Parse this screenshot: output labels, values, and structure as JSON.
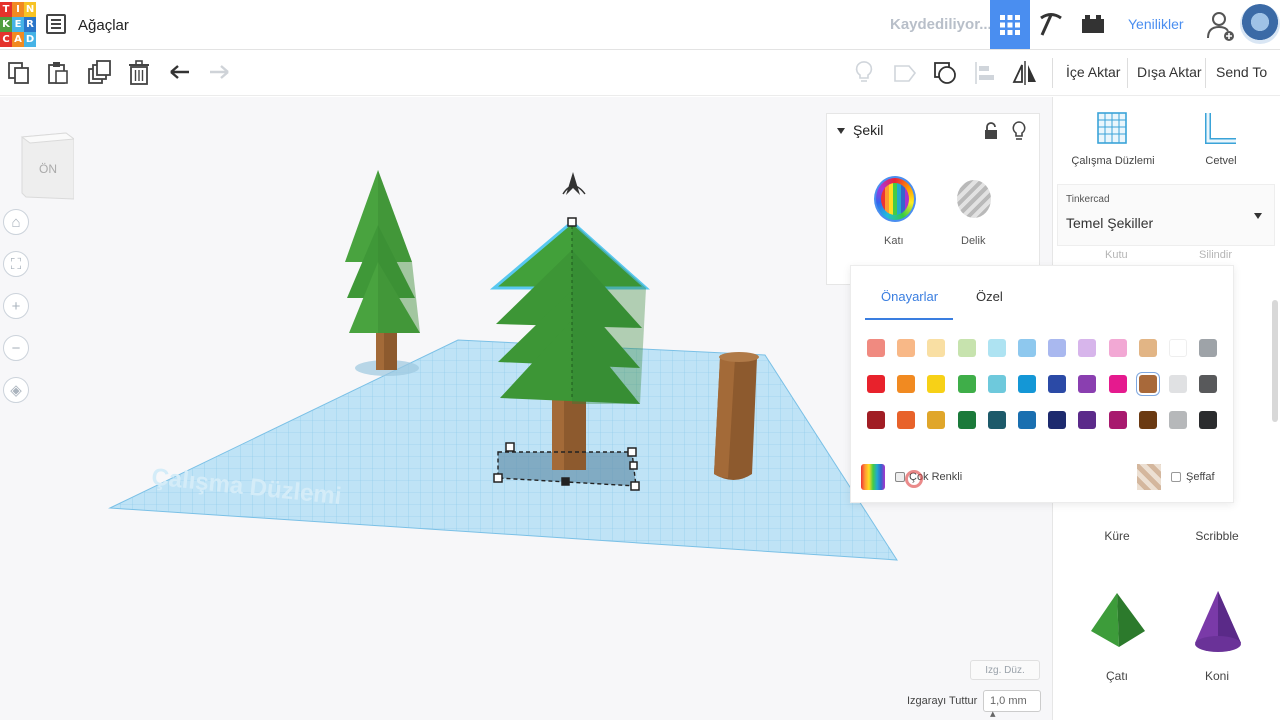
{
  "app": {
    "logo_letters": [
      "T",
      "I",
      "N",
      "K",
      "E",
      "R",
      "C",
      "A",
      "D"
    ],
    "logo_colors": [
      "#e4322b",
      "#f18a21",
      "#f7c325",
      "#4f9c3e",
      "#46b3e6",
      "#2b76c9",
      "#e4322b",
      "#f18a21",
      "#46b3e6"
    ],
    "doc_title": "Ağaçlar",
    "save_status": "Kaydediliyor...",
    "whats_new": "Yenilikler"
  },
  "toolbar": {
    "import": "İçe Aktar",
    "export": "Dışa Aktar",
    "send_to": "Send To"
  },
  "workspace": {
    "viewcube_face": "ÖN",
    "workplane_watermark": "Çalışma Düzlemi",
    "edit_grid": "Izg. Düz.",
    "snap_grid_label": "Izgarayı Tuttur",
    "snap_grid_value": "1,0 mm ▴"
  },
  "inspector": {
    "title": "Şekil",
    "solid_label": "Katı",
    "hole_label": "Delik"
  },
  "color_popup": {
    "tabs": [
      "Önayarlar",
      "Özel"
    ],
    "multicolor_label": "Çok Renkli",
    "transparent_label": "Şeffaf",
    "rows": [
      [
        "#f08a80",
        "#f8b887",
        "#f9dfa3",
        "#c7e3ae",
        "#aee3f2",
        "#8ec8ee",
        "#a9b8ef",
        "#d7b5eb",
        "#f2a8d4",
        "#e2b585",
        "#ffffff",
        "#9ea3a8"
      ],
      [
        "#e8222c",
        "#f18a21",
        "#f7d117",
        "#3fae49",
        "#6ec9dc",
        "#1497d6",
        "#2b4aa6",
        "#8a3fb0",
        "#e51a8e",
        "#a8693a",
        "#e0e1e3",
        "#58595b"
      ],
      [
        "#a11d24",
        "#e8622a",
        "#e0a62a",
        "#1b7a3a",
        "#1d5a6a",
        "#1a6fb0",
        "#1d2a6e",
        "#5b2a8a",
        "#a8196e",
        "#6b3a12",
        "#b6b8ba",
        "#2b2c2e"
      ]
    ],
    "selected": [
      1,
      9
    ]
  },
  "right_panel": {
    "workplane_label": "Çalışma Düzlemi",
    "ruler_label": "Cetvel",
    "library_group": "Tinkercad",
    "library_name": "Temel Şekiller",
    "shape_box": "Kutu",
    "shape_cylinder": "Silindir",
    "shape_sphere": "Küre",
    "shape_scribble": "Scribble",
    "shape_roof": "Çatı",
    "shape_cone": "Koni"
  }
}
